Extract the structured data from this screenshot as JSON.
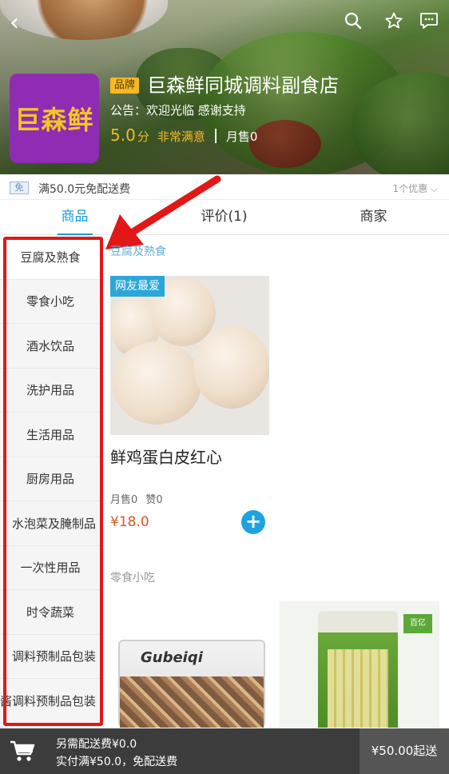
{
  "header": {
    "logo_text": "巨森鲜",
    "brand_badge": "品牌",
    "store_name": "巨森鲜同城调料副食店",
    "notice": "公告：欢迎光临   感谢支持",
    "score": "5.0",
    "score_unit": "分",
    "satisfaction": "非常满意",
    "monthly_sales": "月售0"
  },
  "promo": {
    "badge": "免",
    "text": "满50.0元免配送费",
    "count": "1个优惠 ⌵"
  },
  "tabs": [
    {
      "label": "商品"
    },
    {
      "label": "评价(1)"
    },
    {
      "label": "商家"
    }
  ],
  "sidebar": {
    "categories": [
      "豆腐及熟食",
      "零食小吃",
      "酒水饮品",
      "洗护用品",
      "生活用品",
      "厨房用品",
      "水泡菜及腌制品",
      "一次性用品",
      "时令蔬菜",
      "调料预制品包装",
      "酱调料预制品包装"
    ]
  },
  "sections": [
    {
      "title": "豆腐及熟食"
    },
    {
      "title": "零食小吃"
    }
  ],
  "product": {
    "tag": "网友最爱",
    "name": "鲜鸡蛋白皮红心",
    "sales": "月售0",
    "likes": "赞0",
    "price": "¥18.0"
  },
  "snacks": {
    "box_brand": "Gubeiqi",
    "bag_tag": "百亿"
  },
  "cart": {
    "fee_line1": "另需配送费¥0.0",
    "fee_line2": "实付满¥50.0，免配送费",
    "checkout": "¥50.00起送"
  },
  "colors": {
    "accent": "#1a9de0",
    "price": "#e0541f",
    "highlight_box": "#e21818",
    "logo_bg": "#8e2db3",
    "logo_text": "#f2c624"
  }
}
